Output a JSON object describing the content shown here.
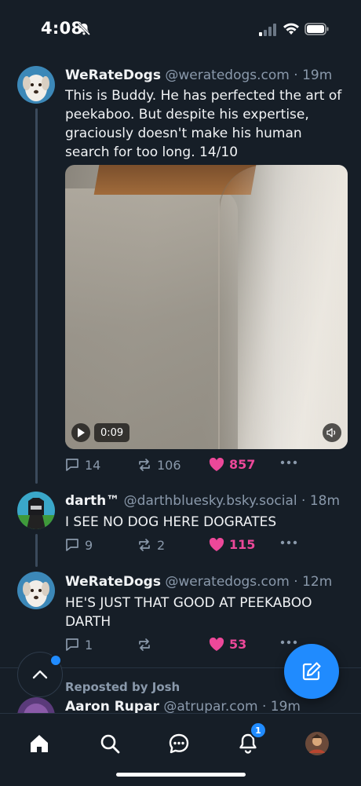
{
  "status_bar": {
    "time": "4:08"
  },
  "feed": {
    "posts": [
      {
        "author": "WeRateDogs",
        "handle": "@weratedogs.com",
        "time": "19m",
        "text": "This is Buddy. He has perfected the art of peekaboo. But despite his expertise, graciously doesn't make his human search for too long. 14/10",
        "video": {
          "duration": "0:09"
        },
        "replies": "14",
        "reposts": "106",
        "likes": "857"
      },
      {
        "author": "darth™",
        "handle": "@darthbluesky.bsky.social",
        "time": "18m",
        "text": "I SEE NO DOG HERE DOGRATES",
        "replies": "9",
        "reposts": "2",
        "likes": "115"
      },
      {
        "author": "WeRateDogs",
        "handle": "@weratedogs.com",
        "time": "12m",
        "text": "HE'S JUST THAT GOOD AT PEEKABOO DARTH",
        "replies": "1",
        "reposts": "",
        "likes": "53"
      }
    ],
    "reposted_by": "Reposted by Josh",
    "next_post": {
      "author": "Aaron Rupar",
      "handle": "@atrupar.com",
      "time": "19m"
    }
  },
  "separator": "·",
  "tab_bar": {
    "notifications_badge": "1"
  },
  "colors": {
    "accent": "#208bfe",
    "like": "#ec4899",
    "background": "#161e27",
    "muted": "#8a99ab"
  }
}
